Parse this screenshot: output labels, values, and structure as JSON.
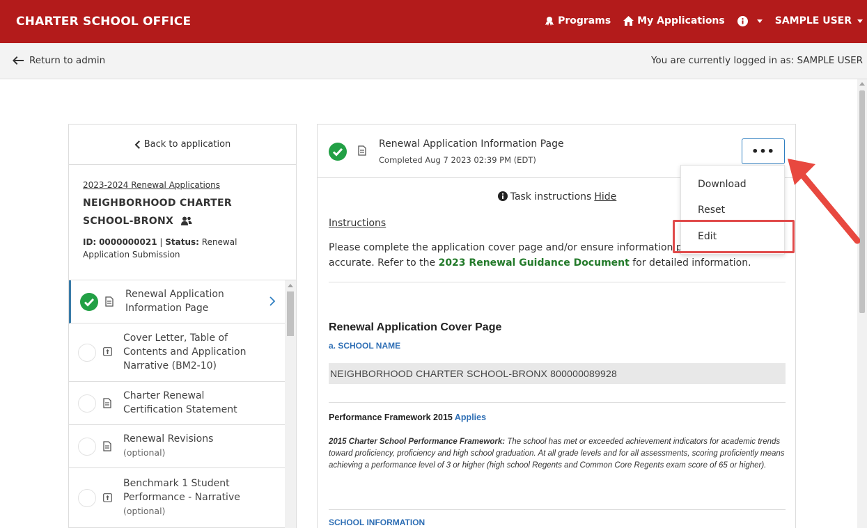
{
  "topbar": {
    "brand": "CHARTER SCHOOL OFFICE",
    "programs": "Programs",
    "my_applications": "My Applications",
    "user": "SAMPLE USER"
  },
  "subbar": {
    "return": "Return to admin",
    "logged_in": "You are currently logged in as: SAMPLE USER"
  },
  "sidebar": {
    "back": "Back to application",
    "app_type": "2023-2024 Renewal Applications",
    "school_name": "NEIGHBORHOOD CHARTER SCHOOL-BRONX",
    "id_label": "ID:",
    "id_value": "0000000021",
    "status_label": "Status:",
    "status_value": "Renewal Application Submission",
    "tasks": [
      {
        "label": "Renewal Application Information Page",
        "optional": "",
        "status": "done"
      },
      {
        "label": "Cover Letter, Table of Contents and Application Narrative (BM2-10)",
        "optional": "",
        "status": "todo"
      },
      {
        "label": "Charter Renewal Certification Statement",
        "optional": "",
        "status": "todo"
      },
      {
        "label": "Renewal Revisions",
        "optional": "(optional)",
        "status": "todo"
      },
      {
        "label": "Benchmark 1 Student Performance - Narrative",
        "optional": "(optional)",
        "status": "todo"
      }
    ]
  },
  "main": {
    "title": "Renewal Application Information Page",
    "completed": "Completed Aug 7 2023 02:39 PM (EDT)",
    "more_button": "•••",
    "task_instructions": "Task instructions",
    "hide": "Hide",
    "instructions_heading": "Instructions",
    "instr_text_1": "Please complete the application cover page and/or ensure information p",
    "instr_text_2": "accurate. Refer to the",
    "guidance_link": "2023 Renewal Guidance Document",
    "instr_text_3": "for detailed information.",
    "cover_title": "Renewal Application Cover Page",
    "school_label": "a. SCHOOL NAME",
    "school_value": "NEIGHBORHOOD CHARTER SCHOOL-BRONX 800000089928",
    "pf_title": "Performance Framework 2015",
    "pf_applies": "Applies",
    "pf_bold": "2015 Charter School Performance Framework:",
    "pf_text": "The school has met or exceeded achievement indicators for academic trends toward proficiency, proficiency and high school graduation. At all grade levels and for all assessments, scoring proficiently means achieving a performance level of 3 or higher (high school Regents and Common Core Regents exam score of 65 or higher).",
    "section_label": "SCHOOL INFORMATION"
  },
  "dropdown": {
    "download": "Download",
    "reset": "Reset",
    "edit": "Edit"
  },
  "colors": {
    "brand_red": "#b31b1b",
    "success_green": "#22a045",
    "link_blue": "#2f6fb5",
    "highlight_red": "#e04a4a"
  }
}
